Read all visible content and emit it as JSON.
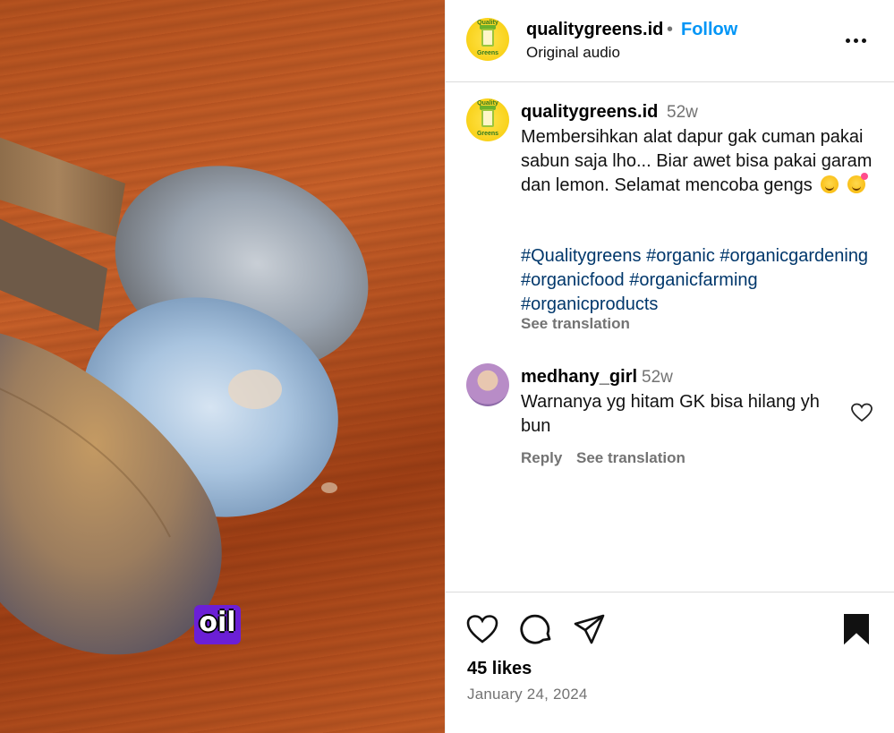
{
  "media": {
    "caption_word": "oil"
  },
  "header": {
    "avatar_text_top": "Quality",
    "avatar_text_bottom": "Greens",
    "username": "qualitygreens.id",
    "separator": "•",
    "follow_label": "Follow",
    "audio_label": "Original audio"
  },
  "caption": {
    "username": "qualitygreens.id",
    "time": "52w",
    "text": "Membersihkan alat dapur gak cuman pakai sabun saja lho... Biar awet bisa pakai garam dan lemon. Selamat mencoba gengs",
    "hashtags": [
      "#Qualitygreens",
      "#organic",
      "#organicgardening",
      "#organicfood",
      "#organicfarming",
      "#organicproducts"
    ],
    "see_translation": "See translation"
  },
  "comment": {
    "username": "medhany_girl",
    "time": "52w",
    "text": "Warnanya yg hitam GK bisa hilang yh bun",
    "reply_label": "Reply",
    "see_translation": "See translation"
  },
  "footer": {
    "likes": "45 likes",
    "date": "January 24, 2024"
  },
  "icons": {
    "more": "more-options-icon",
    "like": "heart-icon",
    "comment": "comment-icon",
    "share": "share-icon",
    "save": "bookmark-icon"
  },
  "colors": {
    "follow": "#0095f6",
    "hashtag": "#00376b",
    "muted": "#737373"
  }
}
